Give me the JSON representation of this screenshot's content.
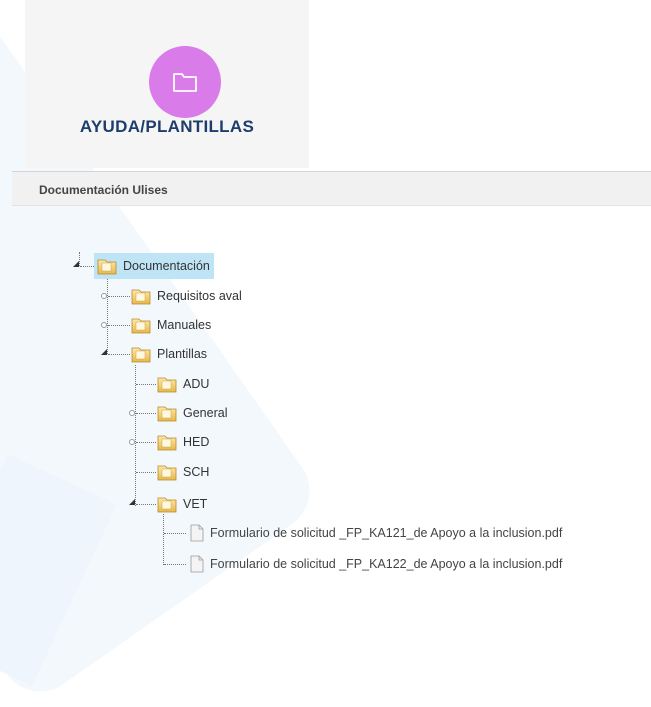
{
  "tile": {
    "icon": "folder-icon",
    "title": "AYUDA/PLANTILLAS",
    "accent": "#d97be8"
  },
  "panel": {
    "title": "Documentación Ulises"
  },
  "tree": {
    "root": "Documentación",
    "requisitos": "Requisitos aval",
    "manuales": "Manuales",
    "plantillas": "Plantillas",
    "adu": "ADU",
    "general": "General",
    "hed": "HED",
    "sch": "SCH",
    "vet": "VET",
    "file1": "Formulario de solicitud _FP_KA121_de Apoyo a la inclusion.pdf",
    "file2": "Formulario de solicitud _FP_KA122_de Apoyo a la inclusion.pdf"
  }
}
